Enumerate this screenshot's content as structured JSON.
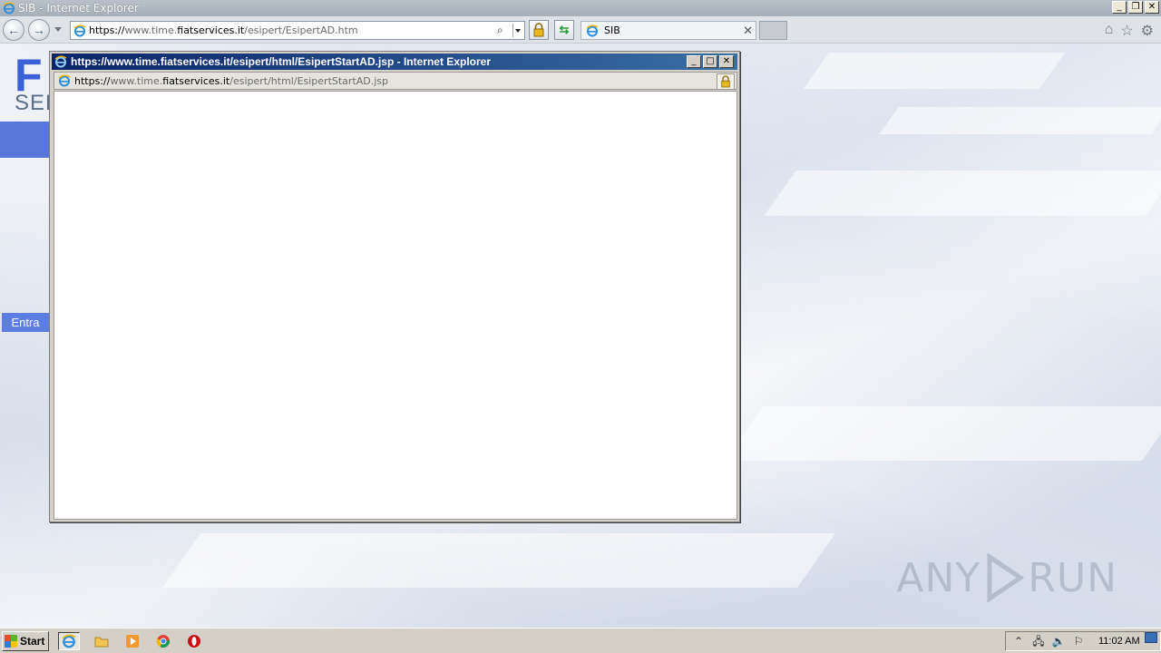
{
  "main_window": {
    "title": "SIB - Internet Explorer",
    "caption_buttons": [
      "minimize",
      "restore",
      "close"
    ],
    "address": {
      "proto": "https://",
      "prefix": "www.time.",
      "domain": "fiatservices.it",
      "path": "/esipert/EsipertAD.htm"
    },
    "tab_label": "SIB",
    "toolbar_icons": [
      "home-icon",
      "favorites-star-icon",
      "tools-gear-icon"
    ]
  },
  "page": {
    "logo_letter": "F",
    "logo_sub": "SER",
    "entra_label": "Entra",
    "watermark": "ANY RUN"
  },
  "popup": {
    "title": "https://www.time.fiatservices.it/esipert/html/EsipertStartAD.jsp - Internet Explorer",
    "address": {
      "proto": "https://",
      "prefix": "www.time.",
      "domain": "fiatservices.it",
      "path": "/esipert/html/EsipertStartAD.jsp"
    }
  },
  "taskbar": {
    "start_label": "Start",
    "clock": "11:02 AM",
    "pinned": [
      "internet-explorer",
      "file-explorer",
      "media-player",
      "chrome",
      "opera"
    ]
  },
  "colors": {
    "accent_blue": "#5775db",
    "popup_title_start": "#0a246a",
    "popup_title_end": "#3a6ea5"
  }
}
